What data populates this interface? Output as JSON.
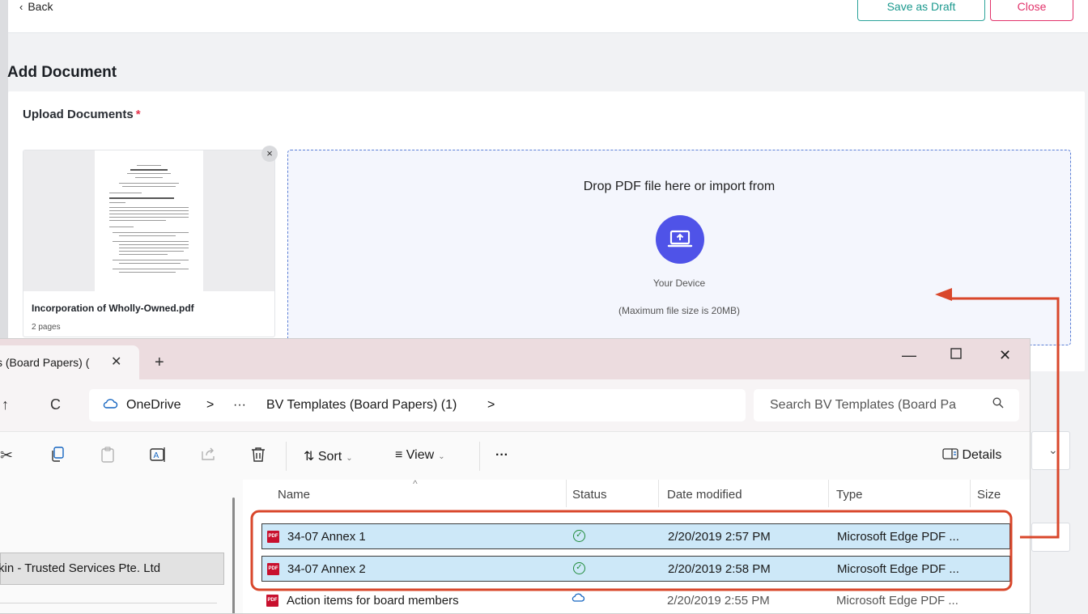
{
  "header": {
    "back_label": "Back",
    "save_draft_label": "Save as Draft",
    "close_label": "Close"
  },
  "page": {
    "title": "Add Document",
    "upload_label": "Upload Documents",
    "required_mark": "*"
  },
  "uploaded_doc": {
    "name": "Incorporation of Wholly-Owned.pdf",
    "pages": "2 pages",
    "remove_icon": "×"
  },
  "dropzone": {
    "title": "Drop PDF file here or import from",
    "device_label": "Your Device",
    "size_limit": "(Maximum file size is 20MB)",
    "accent_color": "#4f53e8"
  },
  "explorer": {
    "tab_title": "s (Board Papers) (",
    "address": {
      "root": "OneDrive",
      "sep": ">",
      "ellipsis": "···",
      "folder": "BV Templates (Board Papers) (1)"
    },
    "search_placeholder": "Search BV Templates (Board Pa",
    "toolbar": {
      "sort_label": "Sort",
      "view_label": "View",
      "more_label": "···",
      "details_label": "Details"
    },
    "nav": {
      "selected_item": "kin - Trusted Services Pte. Ltd"
    },
    "columns": [
      "Name",
      "Status",
      "Date modified",
      "Type",
      "Size"
    ],
    "files": [
      {
        "name": "34-07 Annex 1",
        "status": "synced",
        "date": "2/20/2019 2:57 PM",
        "type": "Microsoft Edge PDF ...",
        "selected": true
      },
      {
        "name": "34-07 Annex 2",
        "status": "synced",
        "date": "2/20/2019 2:58 PM",
        "type": "Microsoft Edge PDF ...",
        "selected": true
      },
      {
        "name": "Action items for board members",
        "status": "cloud",
        "date": "2/20/2019 2:55 PM",
        "type": "Microsoft Edge PDF ...",
        "selected": false
      }
    ]
  },
  "colors": {
    "teal": "#1b998e",
    "pink": "#e2336b",
    "annotation": "#d9472b",
    "selection": "#cde8f8"
  }
}
